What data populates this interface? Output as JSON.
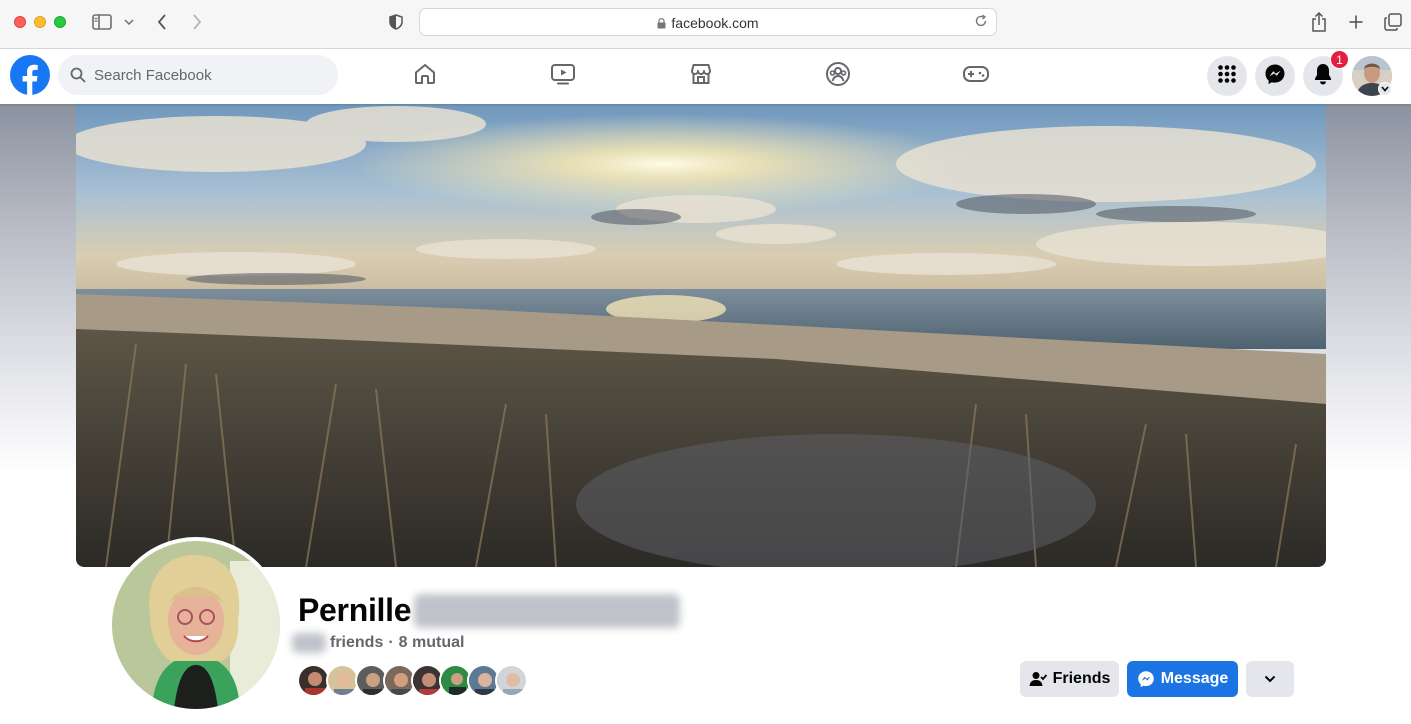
{
  "browser": {
    "address": "facebook.com",
    "icons": [
      "sidebar-icon",
      "chevron-down-icon",
      "back-icon",
      "forward-icon",
      "shield-icon",
      "lock-icon",
      "reload-icon",
      "share-icon",
      "new-tab-icon",
      "tabs-overview-icon"
    ]
  },
  "nav": {
    "search_placeholder": "Search Facebook",
    "tabs": [
      "home-icon",
      "watch-icon",
      "marketplace-icon",
      "groups-icon",
      "gaming-icon"
    ],
    "notification_count": "1",
    "right_icons": [
      "menu-grid-icon",
      "messenger-icon",
      "bell-icon",
      "account-avatar"
    ]
  },
  "profile": {
    "first_name": "Pernille",
    "friends_label": "friends",
    "mutual": "8 mutual",
    "mutual_friend_count_shown": 8,
    "buttons": {
      "friends": "Friends",
      "message": "Message"
    }
  },
  "colors": {
    "brand_blue": "#1877f2",
    "message_button": "#1b74e4",
    "badge_red": "#e41e3f",
    "secondary_button": "#e4e6eb"
  }
}
